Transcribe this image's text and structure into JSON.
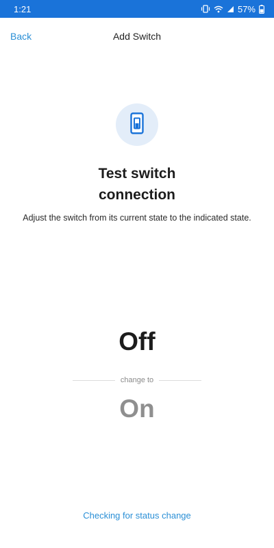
{
  "status_bar": {
    "time": "1:21",
    "battery": "57%",
    "icons": [
      "vibrate-icon",
      "wifi-icon",
      "signal-icon",
      "battery-icon"
    ],
    "background_color": "#1a73d9"
  },
  "header": {
    "back_label": "Back",
    "title": "Add Switch"
  },
  "main": {
    "icon": "light-switch-icon",
    "heading_line1": "Test switch",
    "heading_line2": "connection",
    "description": "Adjust the switch from its current state to the indicated state.",
    "current_state": "Off",
    "change_label": "change to",
    "target_state": "On"
  },
  "footer": {
    "status_text": "Checking for status change"
  },
  "colors": {
    "accent": "#2a8fd6",
    "icon_blue": "#1a73d9",
    "icon_circle": "#e3edf9",
    "muted_state": "#8f8f8f"
  }
}
